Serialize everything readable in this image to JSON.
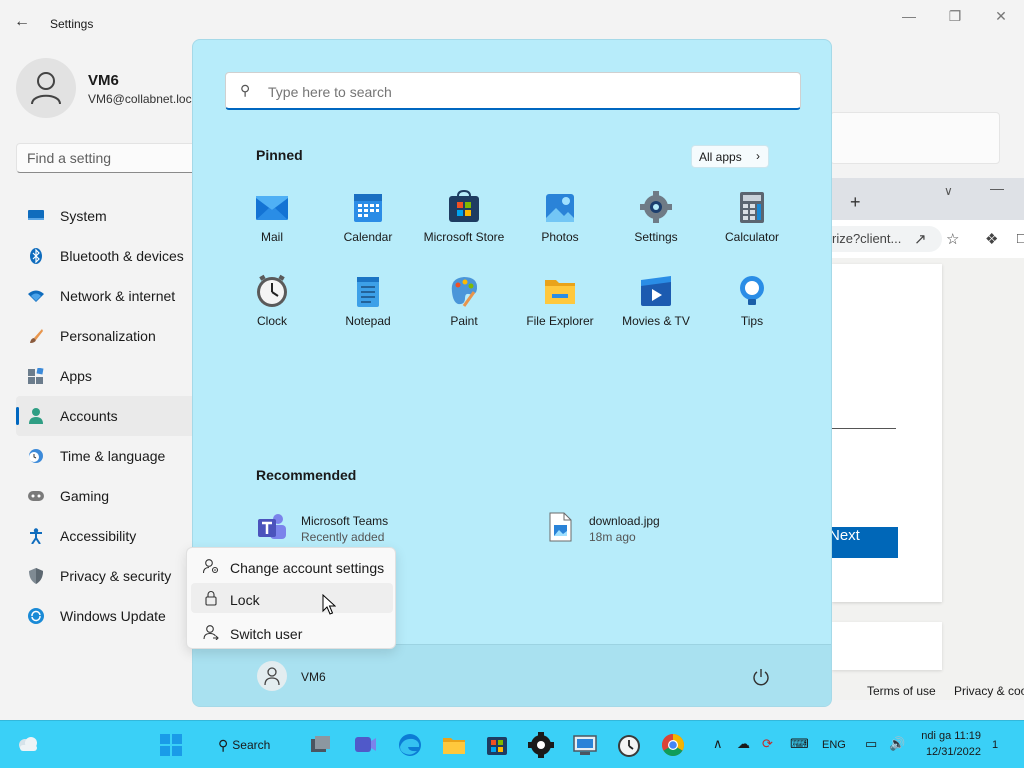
{
  "settings": {
    "title": "Settings",
    "profile": {
      "name": "VM6",
      "email": "VM6@collabnet.loc"
    },
    "search_placeholder": "Find a setting",
    "nav": [
      {
        "label": "System",
        "icon": "monitor-icon"
      },
      {
        "label": "Bluetooth & devices",
        "icon": "bluetooth-icon"
      },
      {
        "label": "Network & internet",
        "icon": "wifi-icon"
      },
      {
        "label": "Personalization",
        "icon": "brush-icon"
      },
      {
        "label": "Apps",
        "icon": "apps-icon"
      },
      {
        "label": "Accounts",
        "icon": "person-icon",
        "active": true
      },
      {
        "label": "Time & language",
        "icon": "clock-globe-icon"
      },
      {
        "label": "Gaming",
        "icon": "gamepad-icon"
      },
      {
        "label": "Accessibility",
        "icon": "accessibility-icon"
      },
      {
        "label": "Privacy & security",
        "icon": "shield-icon"
      },
      {
        "label": "Windows Update",
        "icon": "update-icon"
      }
    ]
  },
  "browser": {
    "url_fragment": "rize?client...",
    "next_label": "Next",
    "terms_label": "Terms of use",
    "privacy_label": "Privacy & coo"
  },
  "start_menu": {
    "search_placeholder": "Type here to search",
    "pinned_title": "Pinned",
    "all_apps_label": "All apps",
    "pinned": [
      {
        "label": "Mail",
        "icon": "mail-icon"
      },
      {
        "label": "Calendar",
        "icon": "calendar-icon"
      },
      {
        "label": "Microsoft Store",
        "icon": "store-icon"
      },
      {
        "label": "Photos",
        "icon": "photos-icon"
      },
      {
        "label": "Settings",
        "icon": "settings-gear-icon"
      },
      {
        "label": "Calculator",
        "icon": "calculator-icon"
      },
      {
        "label": "Clock",
        "icon": "clock-icon"
      },
      {
        "label": "Notepad",
        "icon": "notepad-icon"
      },
      {
        "label": "Paint",
        "icon": "paint-icon"
      },
      {
        "label": "File Explorer",
        "icon": "folder-icon"
      },
      {
        "label": "Movies & TV",
        "icon": "movies-icon"
      },
      {
        "label": "Tips",
        "icon": "tips-bulb-icon"
      }
    ],
    "recommended_title": "Recommended",
    "recommended": [
      {
        "name": "Microsoft Teams",
        "sub": "Recently added",
        "icon": "teams-icon"
      },
      {
        "name": "download.jpg",
        "sub": "18m ago",
        "icon": "image-file-icon"
      }
    ],
    "user_name": "VM6"
  },
  "context_menu": {
    "items": [
      {
        "label": "Change account settings",
        "icon": "account-settings-icon"
      },
      {
        "label": "Lock",
        "icon": "lock-icon",
        "hover": true
      },
      {
        "label": "Switch user",
        "icon": "switch-user-icon"
      }
    ]
  },
  "taskbar": {
    "search_label": "Search",
    "language": "ENG",
    "time": "ndi ga 11:19",
    "date": "12/31/2022",
    "notification_count": "1"
  },
  "colors": {
    "start_bg": "#b7ecfa",
    "taskbar_bg": "#3ad0f7",
    "accent": "#0067c0"
  }
}
